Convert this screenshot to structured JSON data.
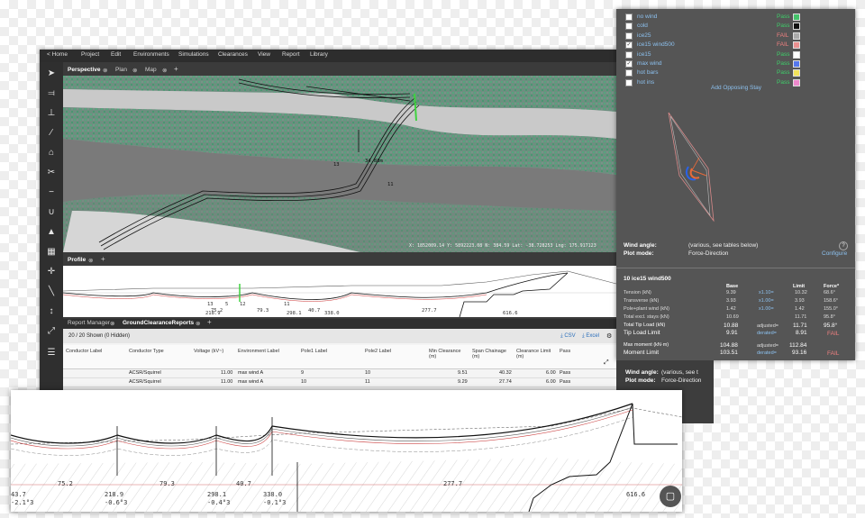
{
  "menu": [
    "< Home",
    "Project",
    "Edit",
    "Environments",
    "Simulations",
    "Clearances",
    "View",
    "Report",
    "Library"
  ],
  "view_tabs": [
    "Perspective",
    "Plan",
    "Map"
  ],
  "viewport": {
    "span_labels": [
      "13",
      "34.88m",
      "11"
    ],
    "status_line": "X: 1852009.14  Y: 5892223.08  N: 384.59  Lat: -38.728253 Lng: 175.917123"
  },
  "profile_tab": "Profile",
  "profile_labels": [
    "13",
    "5",
    "12",
    "11",
    "75.2",
    "79.3",
    "40.7",
    "277.7",
    "616.6",
    "218.9",
    "298.1",
    "338.0"
  ],
  "report": {
    "tabs": [
      "Report Manager",
      "GroundClearanceReports"
    ],
    "shown": "20 / 20 Shown (0 Hidden)",
    "csv": "CSV",
    "excel": "Excel",
    "columns": [
      "Conductor Label",
      "Conductor Type",
      "Voltage (kV~)",
      "Environment Label",
      "Pole1 Label",
      "Pole2 Label",
      "Min Clearance (m)",
      "Span Chainage (m)",
      "Clearance Limit (m)",
      "Pass"
    ],
    "rows": [
      [
        "",
        "ACSR/Squirrel",
        "11.00",
        "max wind A",
        "9",
        "10",
        "9.51",
        "40.32",
        "6.00",
        "Pass"
      ],
      [
        "",
        "ACSR/Squirrel",
        "11.00",
        "max wind A",
        "10",
        "11",
        "9.29",
        "27.74",
        "6.00",
        "Pass"
      ]
    ]
  },
  "weather": [
    {
      "name": "no wind",
      "checked": false,
      "status": "Pass",
      "color": "#44c26a"
    },
    {
      "name": "cold",
      "checked": false,
      "status": "Pass",
      "color": "#111111"
    },
    {
      "name": "ice25",
      "checked": false,
      "status": "FAIL",
      "color": "#aaaaaa"
    },
    {
      "name": "ice15 wind500",
      "checked": true,
      "status": "FAIL",
      "color": "#e99090"
    },
    {
      "name": "ice15",
      "checked": false,
      "status": "Pass",
      "color": "#ffffff"
    },
    {
      "name": "max wind",
      "checked": true,
      "status": "Pass",
      "color": "#5577ee"
    },
    {
      "name": "hot bars",
      "checked": false,
      "status": "Pass",
      "color": "#f2e35a"
    },
    {
      "name": "hot ins",
      "checked": false,
      "status": "Pass",
      "color": "#ee88cc"
    }
  ],
  "add_opposing_stay": "Add Opposing Stay",
  "wind_angle_label": "Wind angle:",
  "wind_angle_value": "(various, see tables below)",
  "plot_mode_label": "Plot mode:",
  "plot_mode_value": "Force-Direction",
  "configure": "Configure",
  "help": "?",
  "loads": {
    "title": "10 ice15 wind500",
    "col_base": "Base",
    "col_limit": "Limit",
    "col_force": "Force*",
    "rows": [
      {
        "label": "Tension (kN)",
        "base": "9.39",
        "mult": "x1.10=",
        "limit": "10.32",
        "force": "68.6°"
      },
      {
        "label": "Transverse (kN)",
        "base": "3.93",
        "mult": "x1.00=",
        "limit": "3.93",
        "force": "158.6°"
      },
      {
        "label": "Pole+plant wind (kN)",
        "base": "1.42",
        "mult": "x1.00=",
        "limit": "1.42",
        "force": "155.0°"
      },
      {
        "label": "Total excl. stays (kN)",
        "base": "10.69",
        "mult": "",
        "limit": "11.71",
        "force": "95.8°"
      }
    ],
    "tip_total_label": "Total Tip Load (kN)",
    "tip_total_base": "10.88",
    "tip_total_mult": "adjusted=",
    "tip_total_limit": "11.71",
    "tip_total_force": "95.8°",
    "tip_limit_label": "Tip Load Limit",
    "tip_limit_base": "9.91",
    "tip_limit_mult": "derated=",
    "tip_limit_limit": "8.91",
    "tip_limit_status": "FAIL",
    "max_moment_label": "Max moment (kN·m)",
    "max_moment_base": "104.88",
    "max_moment_mult": "adjusted=",
    "max_moment_limit": "112.84",
    "moment_limit_label": "Moment Limit",
    "moment_limit_base": "103.51",
    "moment_limit_mult": "derated=",
    "moment_limit_limit": "93.16",
    "moment_limit_status": "FAIL"
  },
  "panel2": {
    "wind_angle_label": "Wind angle:",
    "wind_angle_value": "(various, see t",
    "plot_mode_label": "Plot mode:",
    "plot_mode_value": "Force-Direction"
  },
  "zoom_labels": {
    "spans": [
      "75.2",
      "79.3",
      "40.7",
      "277.7",
      "616.6"
    ],
    "left_top": "43.7",
    "left_bottom": "-2.1°3",
    "p2_top": "218.9",
    "p2_bottom": "-0.6°3",
    "p3_top": "298.1",
    "p3_bottom": "-0.4°3",
    "p4_top": "338.0",
    "p4_bottom": "-0.1°3"
  },
  "colors": {
    "pass": "#3ecf6a",
    "fail": "#f08080",
    "accent": "#8cc0ee"
  }
}
